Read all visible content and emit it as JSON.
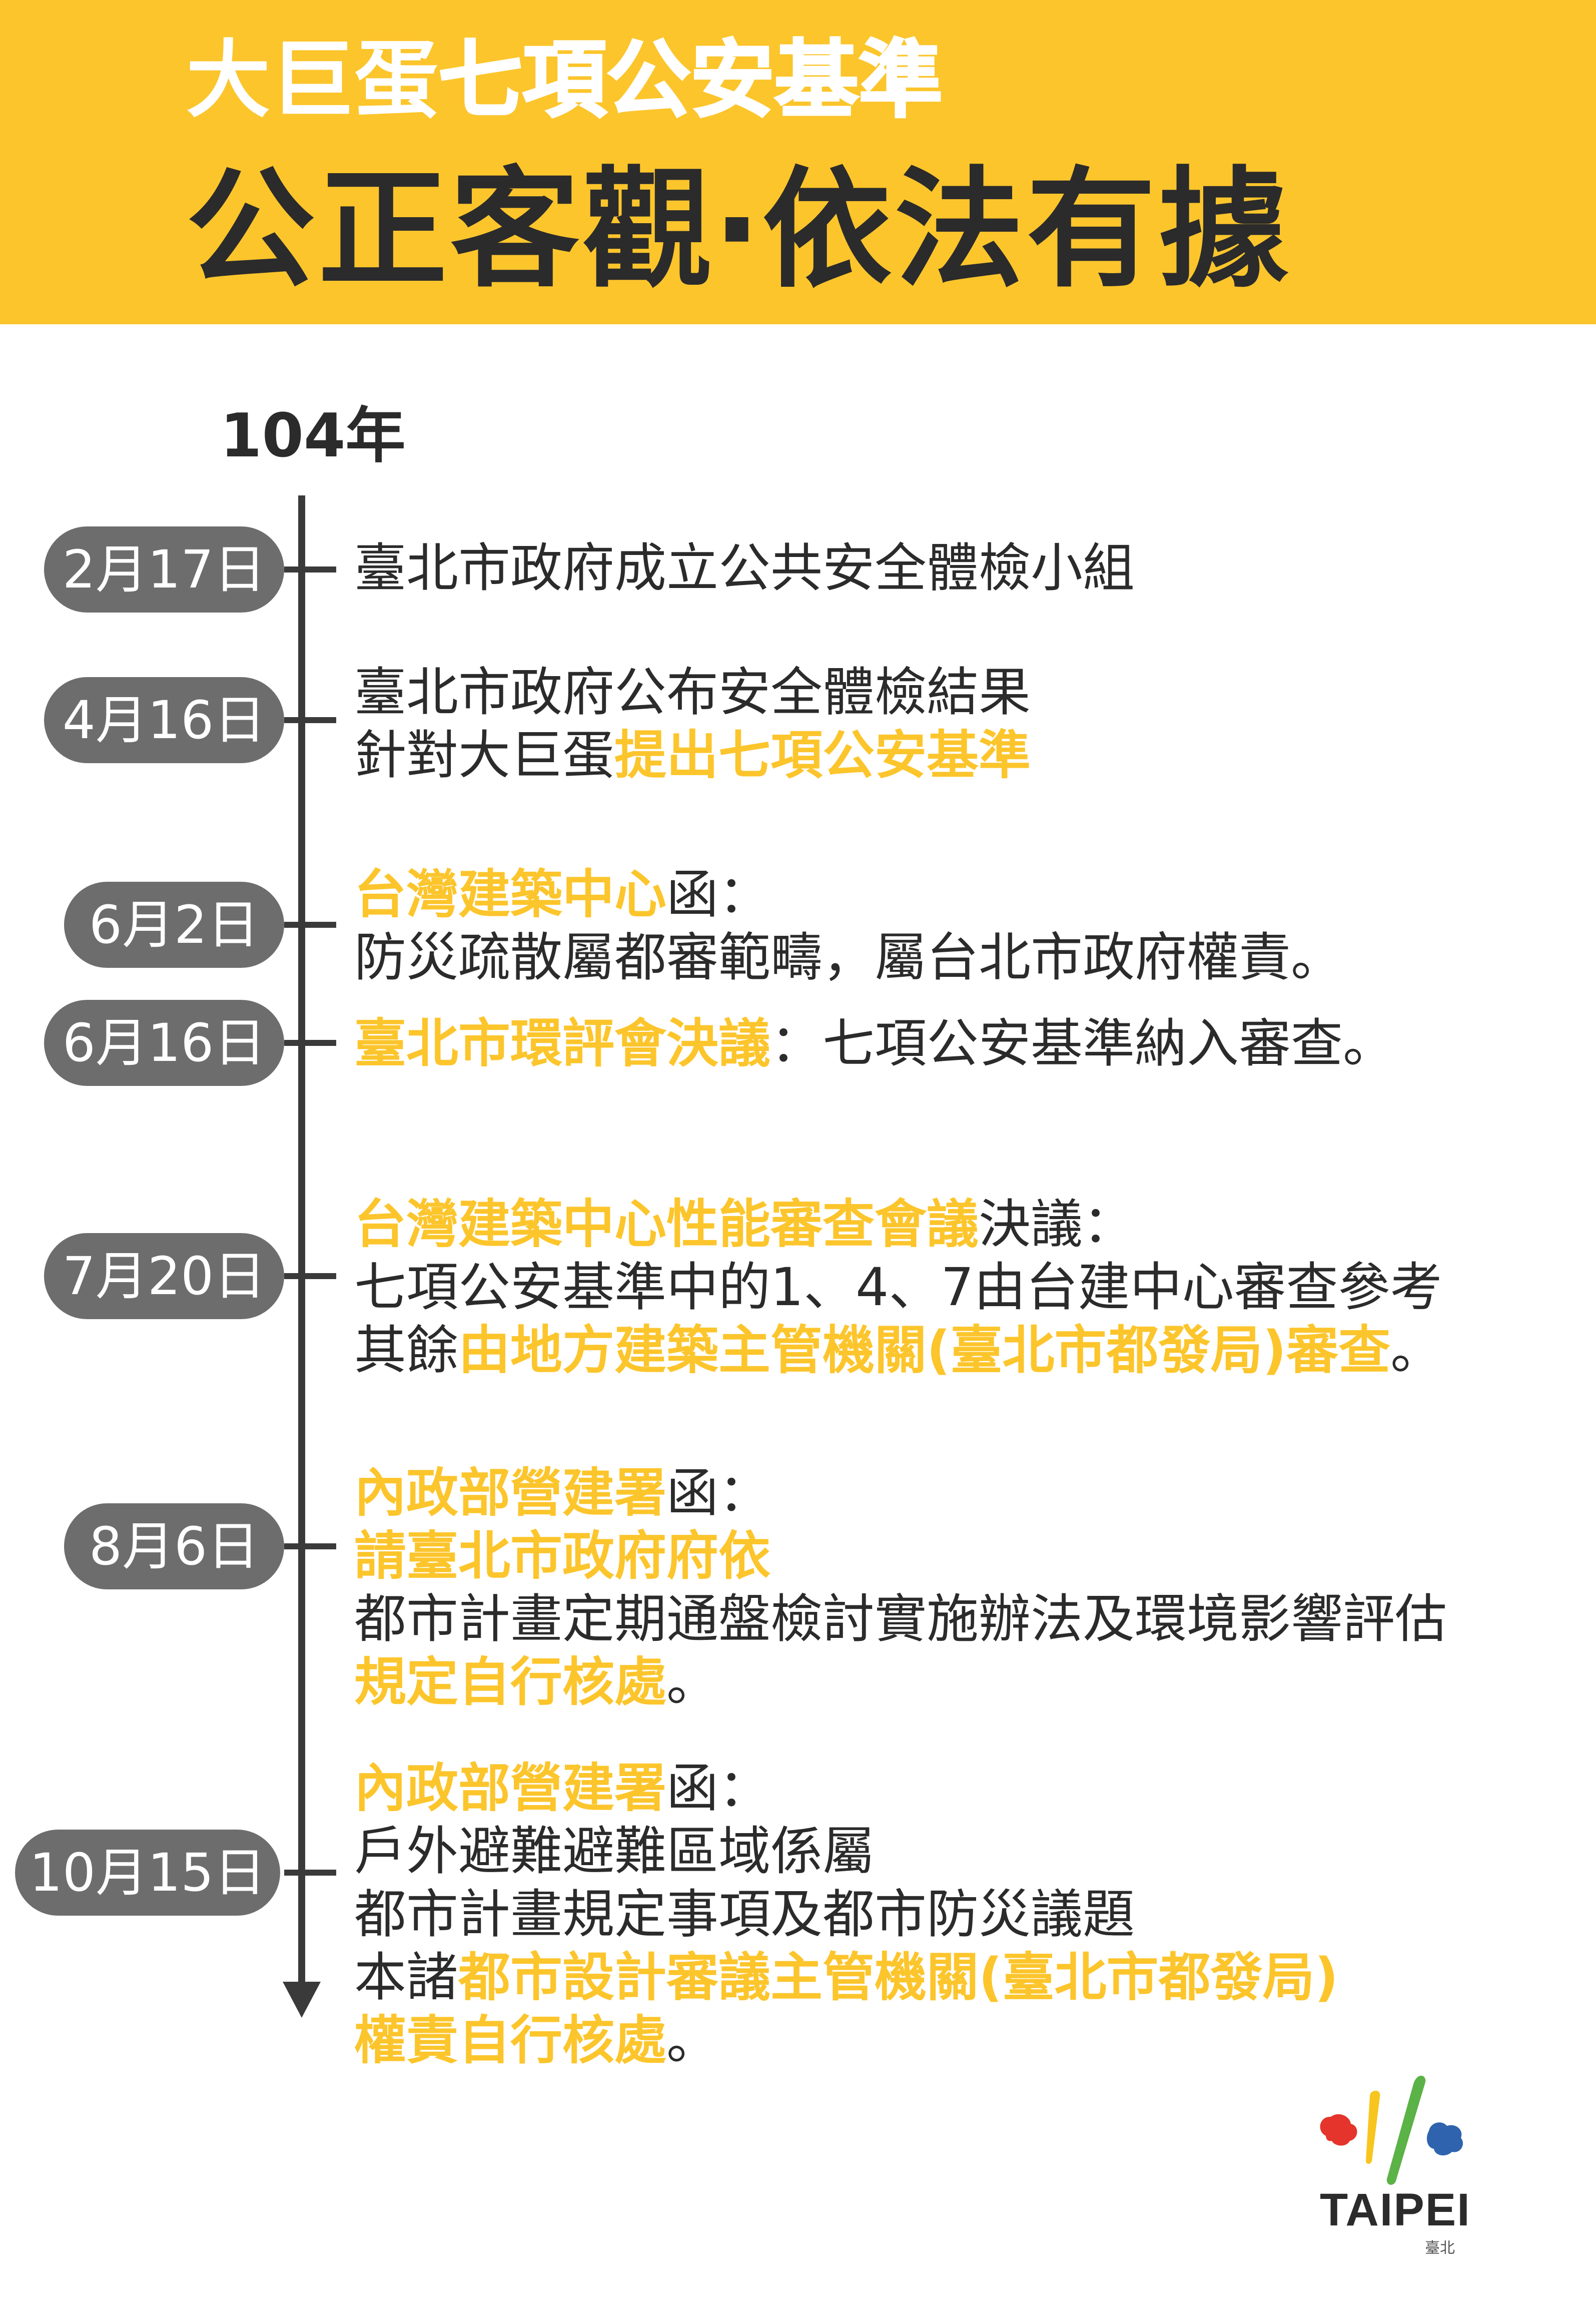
{
  "header": {
    "title_light": "大巨蛋",
    "title_bold": "七項公安基準",
    "subtitle": "公正客觀‧依法有據"
  },
  "timeline": {
    "year": "104年",
    "events": [
      {
        "date": "2月17日",
        "lines": [
          [
            {
              "t": "臺北市政府成立公共安全體檢小組"
            }
          ]
        ]
      },
      {
        "date": "4月16日",
        "lines": [
          [
            {
              "t": "臺北市政府公布安全體檢結果"
            }
          ],
          [
            {
              "t": "針對大巨蛋"
            },
            {
              "t": "提出七項公安基準",
              "hl": true
            }
          ]
        ]
      },
      {
        "date": "6月2日",
        "lines": [
          [
            {
              "t": "台灣建築中心",
              "hl": true
            },
            {
              "t": "函："
            }
          ],
          [
            {
              "t": "防災疏散屬都審範疇，屬台北市政府權責。"
            }
          ]
        ]
      },
      {
        "date": "6月16日",
        "lines": [
          [
            {
              "t": "臺北市環評會決議",
              "hl": true
            },
            {
              "t": "：七項公安基準納入審查。"
            }
          ]
        ]
      },
      {
        "date": "7月20日",
        "lines": [
          [
            {
              "t": "台灣建築中心性能審查會議",
              "hl": true
            },
            {
              "t": "決議："
            }
          ],
          [
            {
              "t": "七項公安基準中的1、4、7由台建中心審查參考"
            }
          ],
          [
            {
              "t": "其餘"
            },
            {
              "t": "由地方建築主管機關(臺北市都發局)審查",
              "hl": true
            },
            {
              "t": "。"
            }
          ]
        ]
      },
      {
        "date": "8月6日",
        "lines": [
          [
            {
              "t": "內政部營建署",
              "hl": true
            },
            {
              "t": "函："
            }
          ],
          [
            {
              "t": "請臺北市政府府依",
              "hl": true
            }
          ],
          [
            {
              "t": "都市計畫定期通盤檢討實施辦法及環境影響評估"
            }
          ],
          [
            {
              "t": "規定自行核處",
              "hl": true
            },
            {
              "t": "。"
            }
          ]
        ]
      },
      {
        "date": "10月15日",
        "lines": [
          [
            {
              "t": "內政部營建署",
              "hl": true
            },
            {
              "t": "函："
            }
          ],
          [
            {
              "t": "戶外避難避難區域係屬"
            }
          ],
          [
            {
              "t": "都市計畫規定事項及都市防災議題"
            }
          ],
          [
            {
              "t": "本諸"
            },
            {
              "t": "都市設計審議主管機關(臺北市都發局)",
              "hl": true
            }
          ],
          [
            {
              "t": "權責自行核處",
              "hl": true
            },
            {
              "t": "。"
            }
          ]
        ]
      }
    ]
  },
  "logo": {
    "text": "TAIPEI",
    "sub": "臺北"
  },
  "colors": {
    "accent": "#fcc52c",
    "pill": "#6d6d6e",
    "text": "#2b2b2b"
  }
}
